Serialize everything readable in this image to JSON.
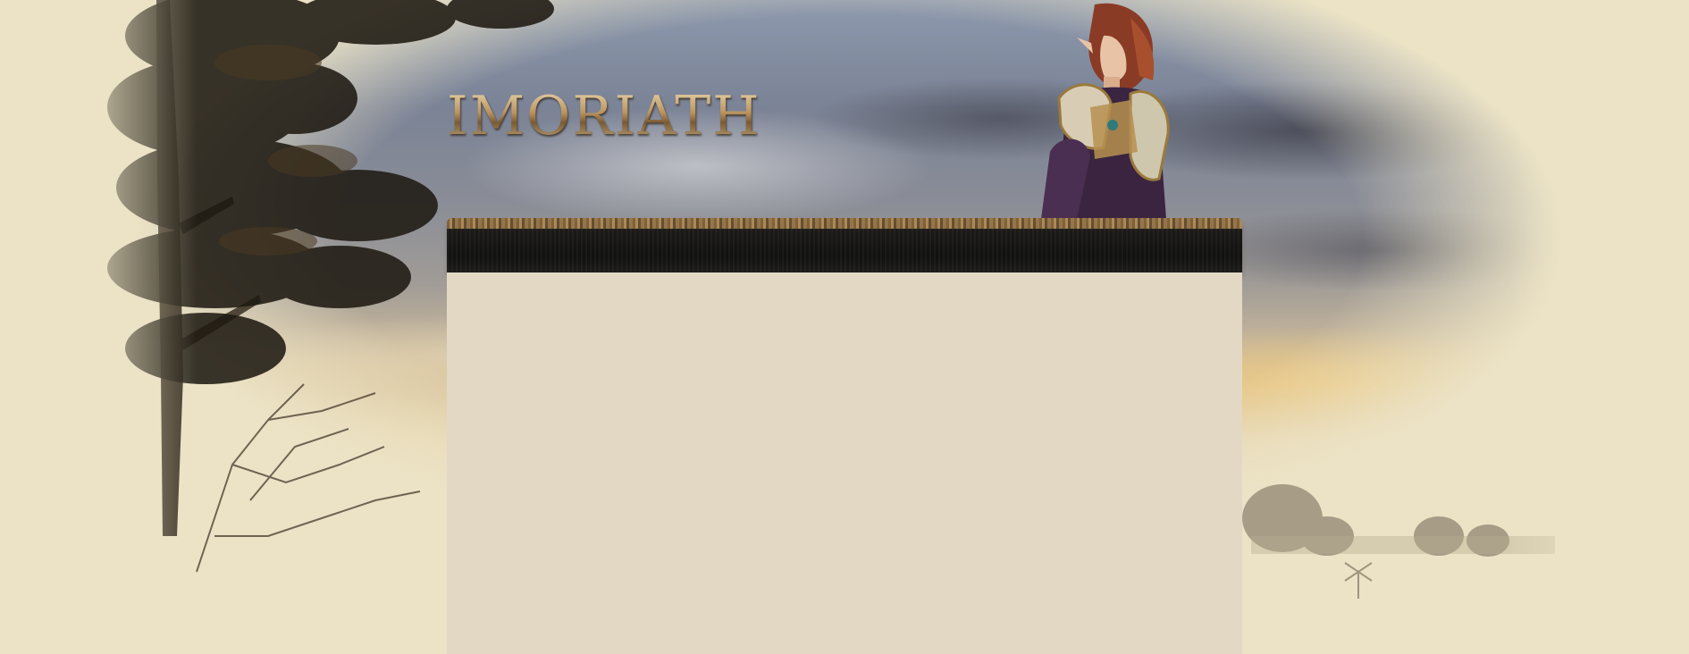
{
  "site": {
    "logo_text": "IMORIATH"
  },
  "colors": {
    "page_background": "#ece3c6",
    "panel_body": "#e2d8c4",
    "panel_header": "#121211",
    "logo_gold": "#c9b18a"
  },
  "icons": {
    "hero_character": "elf-warrior-illustration",
    "hero_tree": "tree-silhouette"
  },
  "main_panel": {
    "header_text": "",
    "body_text": ""
  }
}
